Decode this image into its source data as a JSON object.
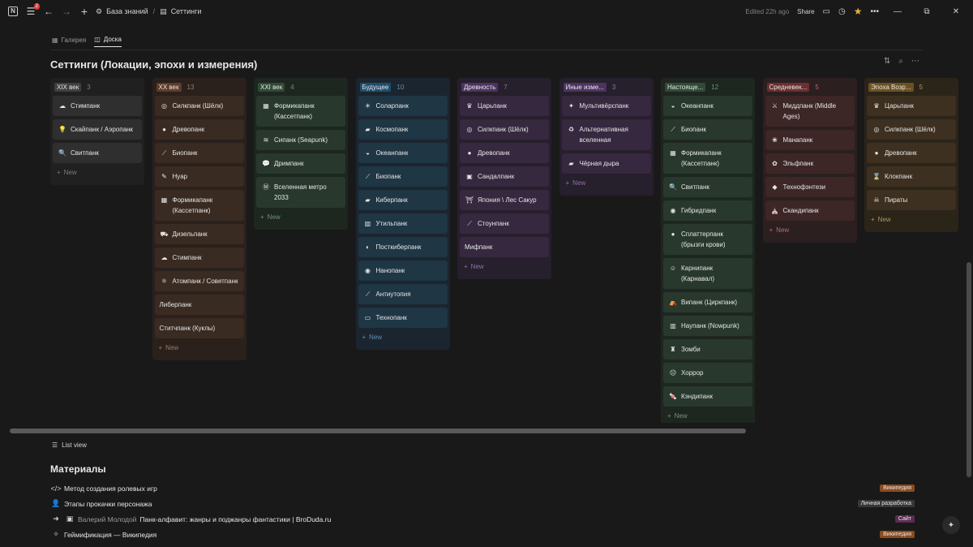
{
  "topbar": {
    "notifications": "2",
    "breadcrumb": [
      "База знаний",
      "Сеттинги"
    ],
    "edited": "Edited 22h ago",
    "share": "Share"
  },
  "tabs": [
    {
      "label": "Галерея",
      "icon": "gallery-icon",
      "active": false
    },
    {
      "label": "Доска",
      "icon": "board-icon",
      "active": true
    }
  ],
  "board": {
    "title": "Сеттинги (Локации, эпохи и измерения)",
    "new_label": "New",
    "columns": [
      {
        "tag": "XIX век",
        "count": "3",
        "colors": {
          "bg": "#202020",
          "card": "#2f2f2f",
          "tag": "#3f3f3f",
          "muted": "#7d7d7d"
        },
        "cards": [
          {
            "icon": "☁",
            "text": "Стимпанк"
          },
          {
            "icon": "💡",
            "text": "Скайпанк / Аэропанк"
          },
          {
            "icon": "🔍",
            "text": "Свитпанк"
          }
        ]
      },
      {
        "tag": "XX век",
        "count": "13",
        "colors": {
          "bg": "#2a211c",
          "card": "#3a2b22",
          "tag": "#5e3c29",
          "muted": "#a07b60"
        },
        "cards": [
          {
            "icon": "◎",
            "text": "Силкпанк (Шёлк)"
          },
          {
            "icon": "●",
            "text": "Древопанк"
          },
          {
            "icon": "⟋",
            "text": "Биопанк"
          },
          {
            "icon": "✎",
            "text": "Нуар"
          },
          {
            "icon": "▦",
            "text": "Формикапанк (Кассетпанк)"
          },
          {
            "icon": "⛟",
            "text": "Дизельпанк"
          },
          {
            "icon": "☁",
            "text": "Стимпанк"
          },
          {
            "icon": "⚛",
            "text": "Атомпанк / Советпанк"
          },
          {
            "icon": "",
            "text": "Либерпанк"
          },
          {
            "icon": "",
            "text": "Ститчпанк (Куклы)"
          }
        ]
      },
      {
        "tag": "XXI век",
        "count": "4",
        "colors": {
          "bg": "#1e2620",
          "card": "#28382d",
          "tag": "#2f4a37",
          "muted": "#6f9478"
        },
        "cards": [
          {
            "icon": "▦",
            "text": "Формикапанк (Кассетпанк)"
          },
          {
            "icon": "≋",
            "text": "Сипанк (Seapunk)"
          },
          {
            "icon": "💬",
            "text": "Дримпанк"
          },
          {
            "icon": "Ⓜ",
            "text": "Вселенная метро 2033"
          }
        ]
      },
      {
        "tag": "Будущее",
        "count": "10",
        "colors": {
          "bg": "#1b2530",
          "card": "#1f3644",
          "tag": "#1f4d6b",
          "muted": "#5f8fb0"
        },
        "cards": [
          {
            "icon": "☀",
            "text": "Соларпанк"
          },
          {
            "icon": "▰",
            "text": "Космопанк"
          },
          {
            "icon": "◒",
            "text": "Океанпанк"
          },
          {
            "icon": "⟋",
            "text": "Биопанк"
          },
          {
            "icon": "▰",
            "text": "Киберпанк"
          },
          {
            "icon": "▥",
            "text": "Утильпанк"
          },
          {
            "icon": "◐",
            "text": "Посткиберпанк"
          },
          {
            "icon": "◉",
            "text": "Нанопанк"
          },
          {
            "icon": "⟋",
            "text": "Антиутопия"
          },
          {
            "icon": "▭",
            "text": "Технопанк"
          }
        ]
      },
      {
        "tag": "Древность",
        "count": "7",
        "colors": {
          "bg": "#261f2c",
          "card": "#36283f",
          "tag": "#4d3360",
          "muted": "#8f73a6"
        },
        "cards": [
          {
            "icon": "♛",
            "text": "Царьпанк"
          },
          {
            "icon": "◎",
            "text": "Силкпанк (Шёлк)"
          },
          {
            "icon": "●",
            "text": "Древопанк"
          },
          {
            "icon": "▣",
            "text": "Сандалпанк"
          },
          {
            "icon": "⛩",
            "text": "Япония \\ Лес Сакур"
          },
          {
            "icon": "⟋",
            "text": "Стоунпанк"
          },
          {
            "icon": "",
            "text": "Мифпанк"
          }
        ]
      },
      {
        "tag": "Иные изме...",
        "count": "3",
        "colors": {
          "bg": "#261f2c",
          "card": "#36283f",
          "tag": "#4d3360",
          "muted": "#8f73a6"
        },
        "cards": [
          {
            "icon": "✦",
            "text": "Мультивёрспанк"
          },
          {
            "icon": "♻",
            "text": "Альтернативная вселенная"
          },
          {
            "icon": "▰",
            "text": "Чёрная дыра"
          }
        ]
      },
      {
        "tag": "Настояще...",
        "count": "12",
        "colors": {
          "bg": "#1e2620",
          "card": "#28382d",
          "tag": "#2f4a37",
          "muted": "#6f9478"
        },
        "cards": [
          {
            "icon": "◒",
            "text": "Океанпанк"
          },
          {
            "icon": "⟋",
            "text": "Биопанк"
          },
          {
            "icon": "▦",
            "text": "Формикапанк (Кассетпанк)"
          },
          {
            "icon": "🔍",
            "text": "Свитпанк"
          },
          {
            "icon": "◉",
            "text": "Гибридпанк"
          },
          {
            "icon": "●",
            "text": "Сплаттерпанк (брызги крови)"
          },
          {
            "icon": "☺",
            "text": "Карнипанк (Карнавал)"
          },
          {
            "icon": "⛺",
            "text": "Випанк (Циркпанк)"
          },
          {
            "icon": "▥",
            "text": "Наупанк (Nowpunk)"
          },
          {
            "icon": "♜",
            "text": "Зомби"
          },
          {
            "icon": "☹",
            "text": "Хоррор"
          },
          {
            "icon": "🍬",
            "text": "Кэндипанк"
          }
        ]
      },
      {
        "tag": "Средневек...",
        "count": "5",
        "colors": {
          "bg": "#2b1f1f",
          "card": "#3d2626",
          "tag": "#6b2f2f",
          "muted": "#b07070"
        },
        "cards": [
          {
            "icon": "⚔",
            "text": "Миддпанк (Middle Ages)"
          },
          {
            "icon": "❀",
            "text": "Манапанк"
          },
          {
            "icon": "✿",
            "text": "Эльфпанк"
          },
          {
            "icon": "◆",
            "text": "Технофэнтези"
          },
          {
            "icon": "⛪",
            "text": "Скандипанк"
          }
        ]
      },
      {
        "tag": "Эпоха Возр...",
        "count": "5",
        "colors": {
          "bg": "#2b2419",
          "card": "#3d3020",
          "tag": "#6b5122",
          "muted": "#b09560"
        },
        "cards": [
          {
            "icon": "♛",
            "text": "Царьпанк"
          },
          {
            "icon": "◎",
            "text": "Силкпанк (Шёлк)"
          },
          {
            "icon": "●",
            "text": "Древопанк"
          },
          {
            "icon": "⌛",
            "text": "Клокпанк"
          },
          {
            "icon": "☠",
            "text": "Пираты"
          }
        ]
      }
    ]
  },
  "list_view": {
    "label": "List view"
  },
  "materials": {
    "title": "Материалы",
    "rows": [
      {
        "icon": "</>",
        "prefix": "",
        "text": "Метод создания ролевых игр",
        "tag": "Википедия",
        "tag_color": "#8a4b1e"
      },
      {
        "icon": "👤",
        "prefix": "",
        "text": "Этапы прокачки персонажа",
        "tag": "Личная разработка",
        "tag_color": "#373737"
      },
      {
        "icon": "➜",
        "prefix": "Валерий Молодой",
        "text": "Панк-алфавит: жанры и поджанры фантастики | BroDuda.ru",
        "tag": "Сайт",
        "tag_color": "#5a2d50"
      },
      {
        "icon": "✧",
        "prefix": "",
        "text": "Геймификация — Википедия",
        "tag": "Википедия",
        "tag_color": "#8a4b1e"
      }
    ]
  }
}
